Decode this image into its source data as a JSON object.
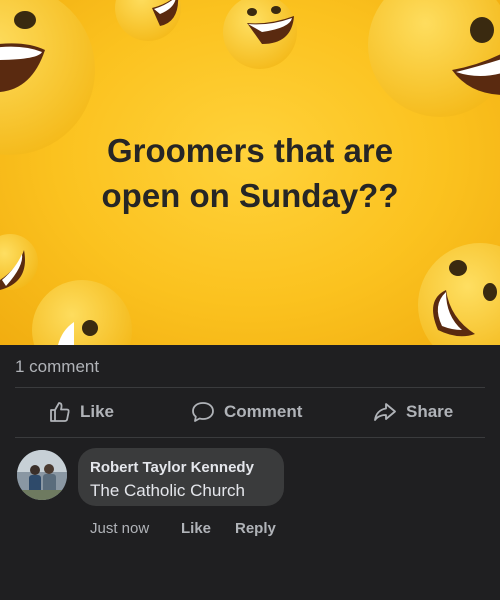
{
  "post": {
    "text_lines": [
      "Groomers that are",
      "open on Sunday??"
    ],
    "background_color": "#fbc21f",
    "decoration": "laughing-emoji-pattern"
  },
  "stats": {
    "comment_count": "1 comment"
  },
  "actions": {
    "like": "Like",
    "comment": "Comment",
    "share": "Share"
  },
  "comment": {
    "author": "Robert Taylor Kennedy",
    "text": "The Catholic Church",
    "time": "Just now",
    "like": "Like",
    "reply": "Reply"
  },
  "colors": {
    "feed_background": "#1f1f21",
    "bubble_background": "#3a3b3c",
    "secondary_text": "#b0b3b8",
    "primary_text": "#e4e6eb"
  }
}
